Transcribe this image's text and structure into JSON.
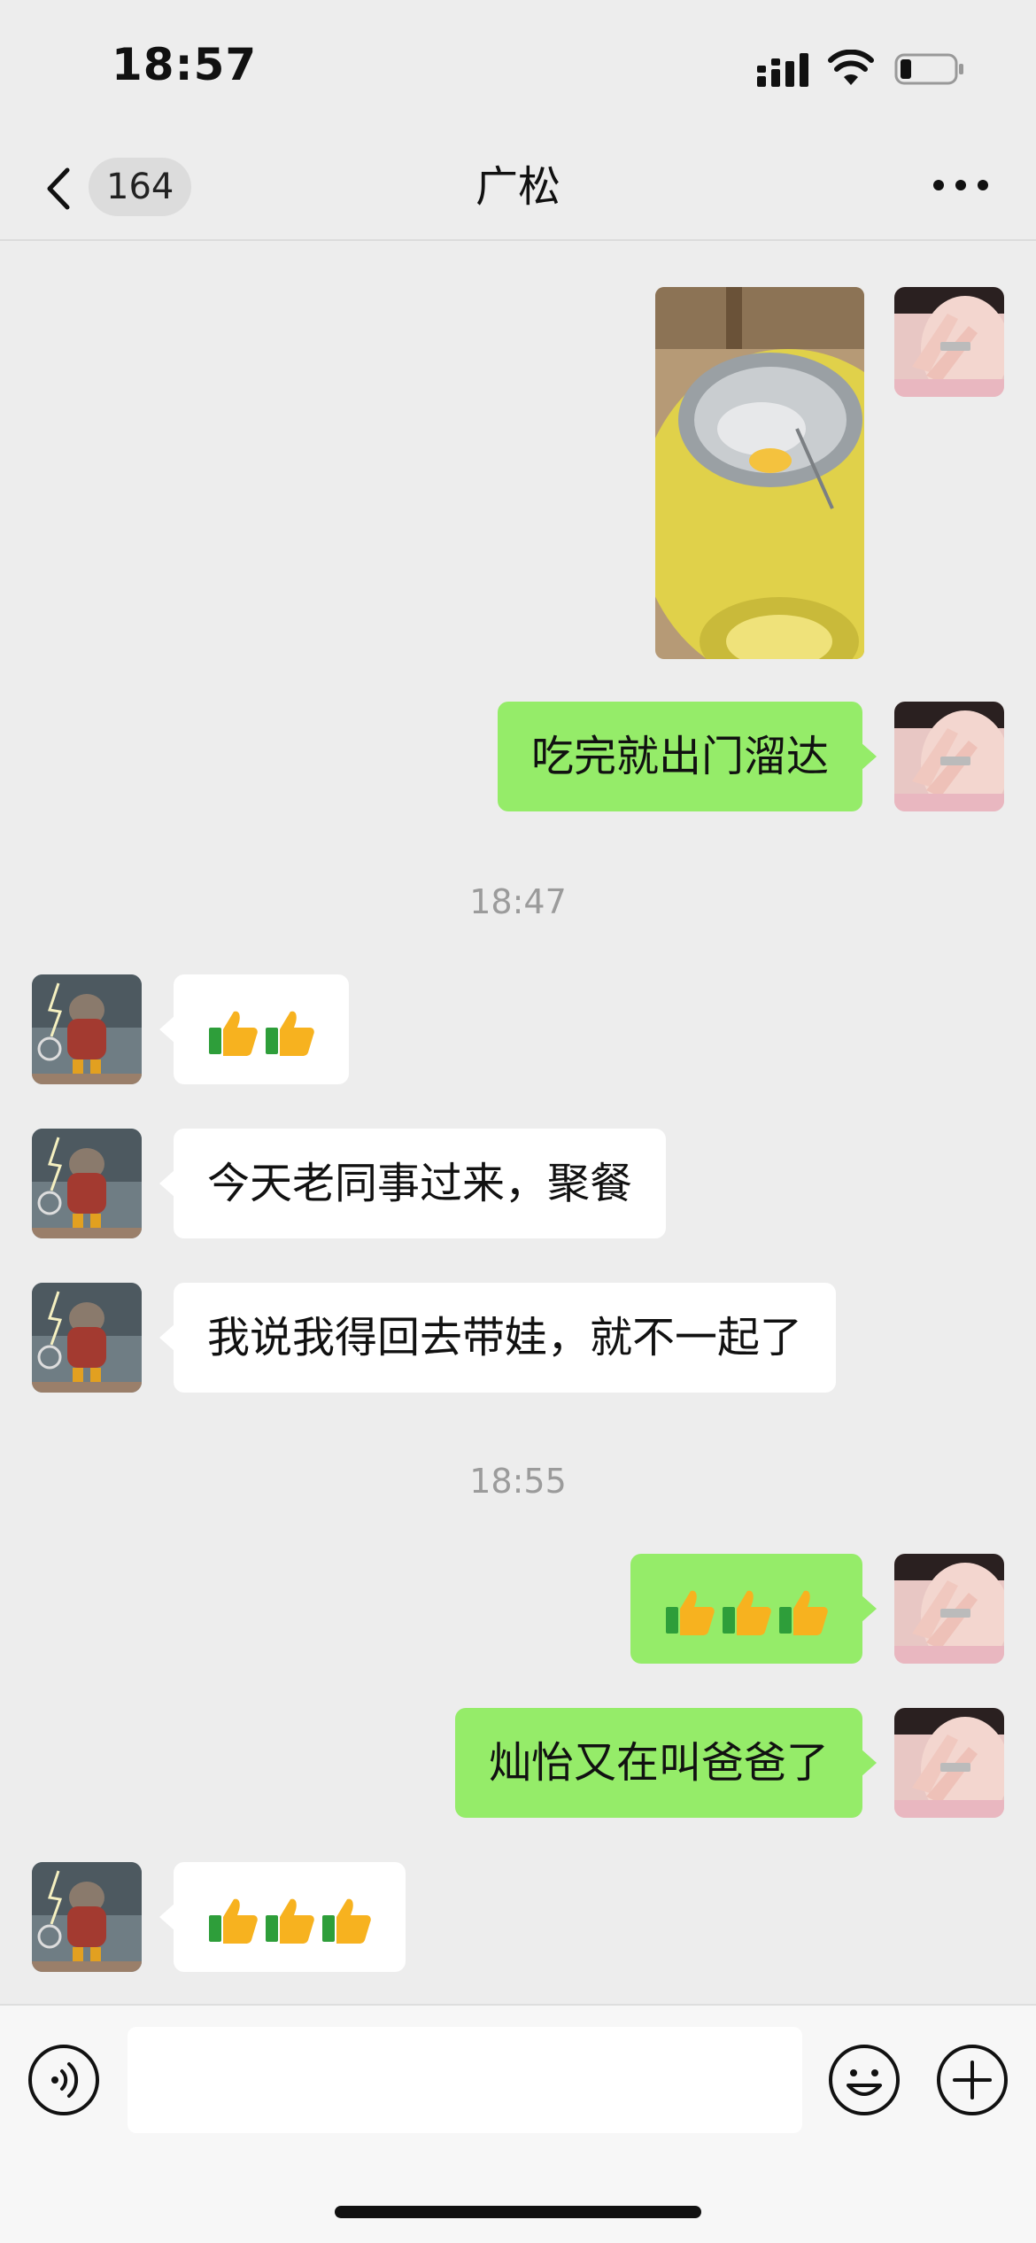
{
  "status_bar": {
    "time": "18:57"
  },
  "nav": {
    "unread_count": "164",
    "title": "广松"
  },
  "messages": [
    {
      "type": "image",
      "sender": "me",
      "description_icon": "photo-bowl"
    },
    {
      "type": "text",
      "sender": "me",
      "text": "吃完就出门溜达"
    },
    {
      "type": "timestamp",
      "text": "18:47"
    },
    {
      "type": "emoji",
      "sender": "other",
      "emoji": "thumbs-up",
      "count": 2
    },
    {
      "type": "text",
      "sender": "other",
      "text": "今天老同事过来，聚餐"
    },
    {
      "type": "text",
      "sender": "other",
      "text": "我说我得回去带娃，就不一起了"
    },
    {
      "type": "timestamp",
      "text": "18:55"
    },
    {
      "type": "emoji",
      "sender": "me",
      "emoji": "thumbs-up",
      "count": 3
    },
    {
      "type": "text",
      "sender": "me",
      "text": "灿怡又在叫爸爸了"
    },
    {
      "type": "emoji",
      "sender": "other",
      "emoji": "thumbs-up",
      "count": 3
    }
  ],
  "input": {
    "value": "",
    "placeholder": ""
  },
  "colors": {
    "me_bubble": "#95ec69",
    "other_bubble": "#ffffff",
    "background": "#ededed"
  },
  "icons": [
    "signal-icon",
    "wifi-icon",
    "battery-icon",
    "back-chevron-icon",
    "more-icon",
    "voice-icon",
    "emoji-icon",
    "plus-icon",
    "thumbs-up-icon"
  ]
}
